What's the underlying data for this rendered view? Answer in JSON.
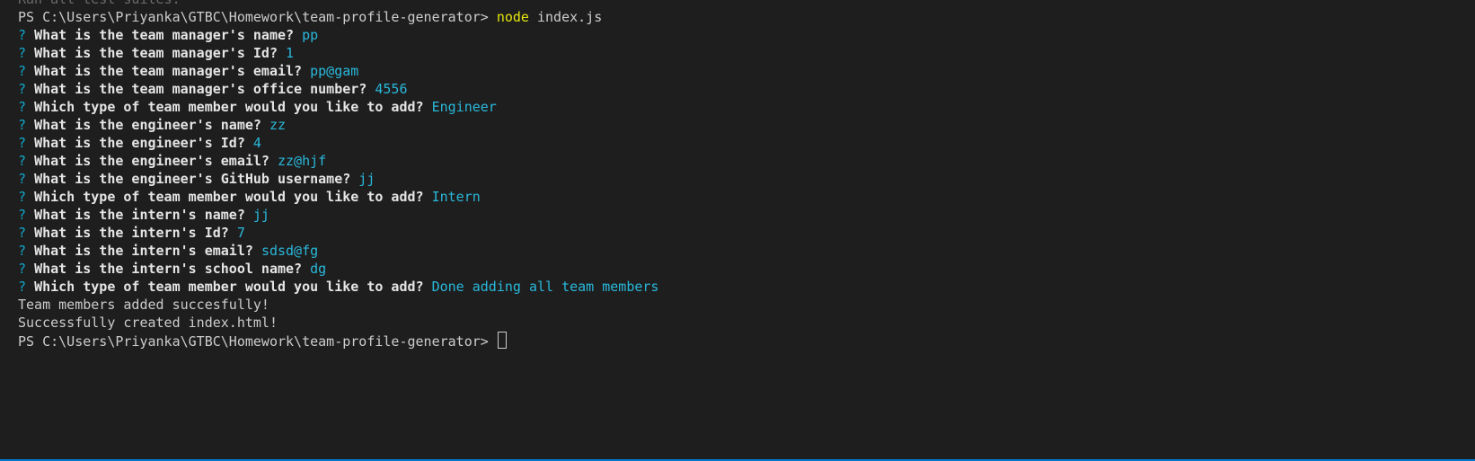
{
  "terminal": {
    "accent_color": "#007acc",
    "prev_output": "Ran all test suites.",
    "prompt": "PS C:\\Users\\Priyanka\\GTBC\\Homework\\team-profile-generator> ",
    "command": {
      "name": "node",
      "args": " index.js"
    },
    "qa": [
      {
        "q": "What is the team manager's name?",
        "a": "pp"
      },
      {
        "q": "What is the team manager's Id?",
        "a": "1"
      },
      {
        "q": "What is the team manager's email?",
        "a": "pp@gam"
      },
      {
        "q": "What is the team manager's office number?",
        "a": "4556"
      },
      {
        "q": "Which type of team member would you like to add?",
        "a": "Engineer"
      },
      {
        "q": "What is the engineer's name?",
        "a": "zz"
      },
      {
        "q": "What is the engineer's Id?",
        "a": "4"
      },
      {
        "q": "What is the engineer's email?",
        "a": "zz@hjf"
      },
      {
        "q": "What is the engineer's GitHub username?",
        "a": "jj"
      },
      {
        "q": "Which type of team member would you like to add?",
        "a": "Intern"
      },
      {
        "q": "What is the intern's name?",
        "a": "jj"
      },
      {
        "q": "What is the intern's Id?",
        "a": "7"
      },
      {
        "q": "What is the intern's email?",
        "a": "sdsd@fg"
      },
      {
        "q": "What is the intern's school name?",
        "a": "dg"
      },
      {
        "q": "Which type of team member would you like to add?",
        "a": "Done adding all team members"
      }
    ],
    "qmark": "?",
    "output": [
      "Team members added succesfully!",
      "Successfully created index.html!"
    ],
    "final_prompt": "PS C:\\Users\\Priyanka\\GTBC\\Homework\\team-profile-generator> "
  }
}
